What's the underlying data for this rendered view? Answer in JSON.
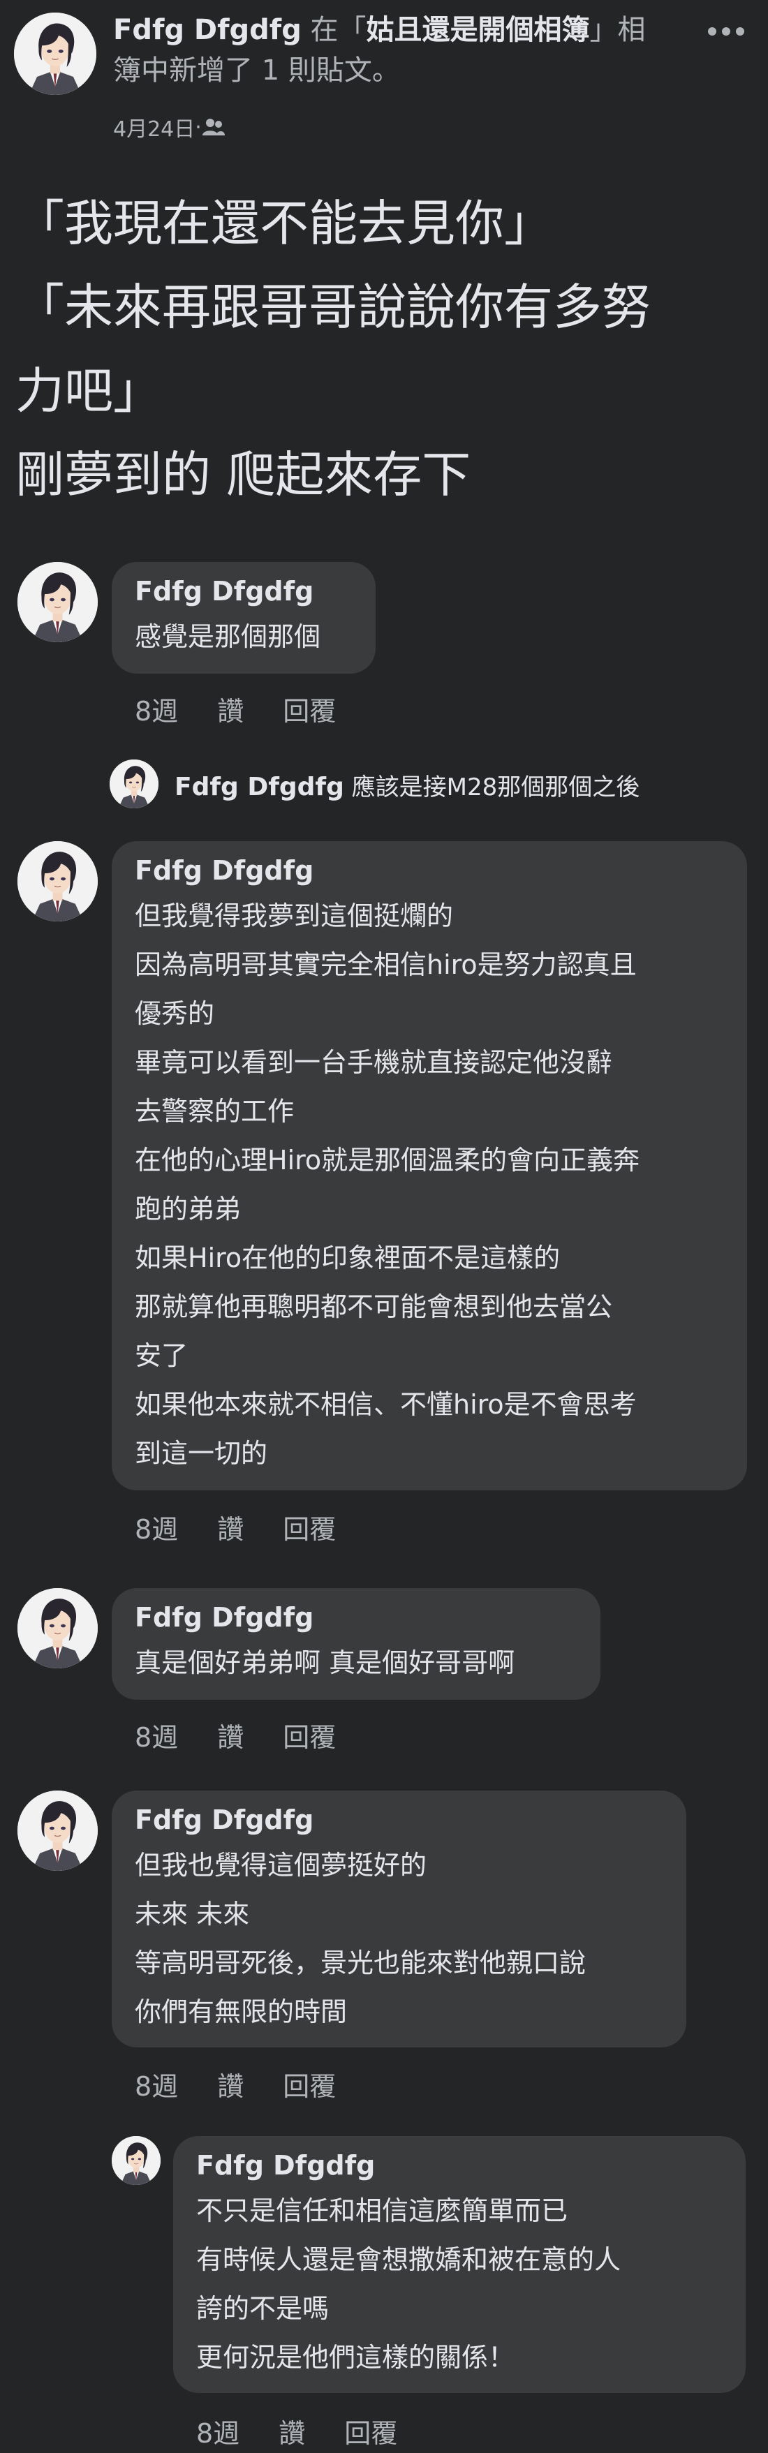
{
  "header": {
    "author": "Fdfg Dfgdfg",
    "connector": " 在「",
    "album": "姑且還是開個相簿",
    "suffix_line1": "」相",
    "suffix_line2": "簿中新增了 1 則貼文。",
    "date": "4月24日",
    "dot": " · ",
    "privacy_icon": "friends-icon",
    "more_icon": "more-icon"
  },
  "post": {
    "lines": [
      "「我現在還不能去見你」",
      "「未來再跟哥哥說說你有多努",
      "力吧」",
      "剛夢到的 爬起來存下"
    ]
  },
  "comments": [
    {
      "name": "Fdfg Dfgdfg",
      "lines": [
        "感覺是那個那個"
      ],
      "time": "8週",
      "like": "讚",
      "reply": "回覆"
    },
    {
      "name": "Fdfg Dfgdfg",
      "text": "應該是接M28那個那個之後"
    },
    {
      "name": "Fdfg Dfgdfg",
      "lines": [
        "但我覺得我夢到這個挺爛的",
        "因為高明哥其實完全相信hiro是努力認真且",
        "優秀的",
        "畢竟可以看到一台手機就直接認定他沒辭",
        "去警察的工作",
        "在他的心理Hiro就是那個溫柔的會向正義奔",
        "跑的弟弟",
        "如果Hiro在他的印象裡面不是這樣的",
        "那就算他再聰明都不可能會想到他去當公",
        "安了",
        "如果他本來就不相信、不懂hiro是不會思考",
        "到這一切的"
      ],
      "time": "8週",
      "like": "讚",
      "reply": "回覆"
    },
    {
      "name": "Fdfg Dfgdfg",
      "lines": [
        "真是個好弟弟啊 真是個好哥哥啊"
      ],
      "time": "8週",
      "like": "讚",
      "reply": "回覆"
    },
    {
      "name": "Fdfg Dfgdfg",
      "lines": [
        "但我也覺得這個夢挺好的",
        "未來 未來",
        "等高明哥死後，景光也能來對他親口說",
        "你們有無限的時間"
      ],
      "time": "8週",
      "like": "讚",
      "reply": "回覆"
    },
    {
      "name": "Fdfg Dfgdfg",
      "lines": [
        "不只是信任和相信這麼簡單而已",
        "有時候人還是會想撒嬌和被在意的人",
        "誇的不是嗎",
        "更何況是他們這樣的關係！"
      ],
      "time": "8週",
      "like": "讚",
      "reply": "回覆"
    }
  ]
}
